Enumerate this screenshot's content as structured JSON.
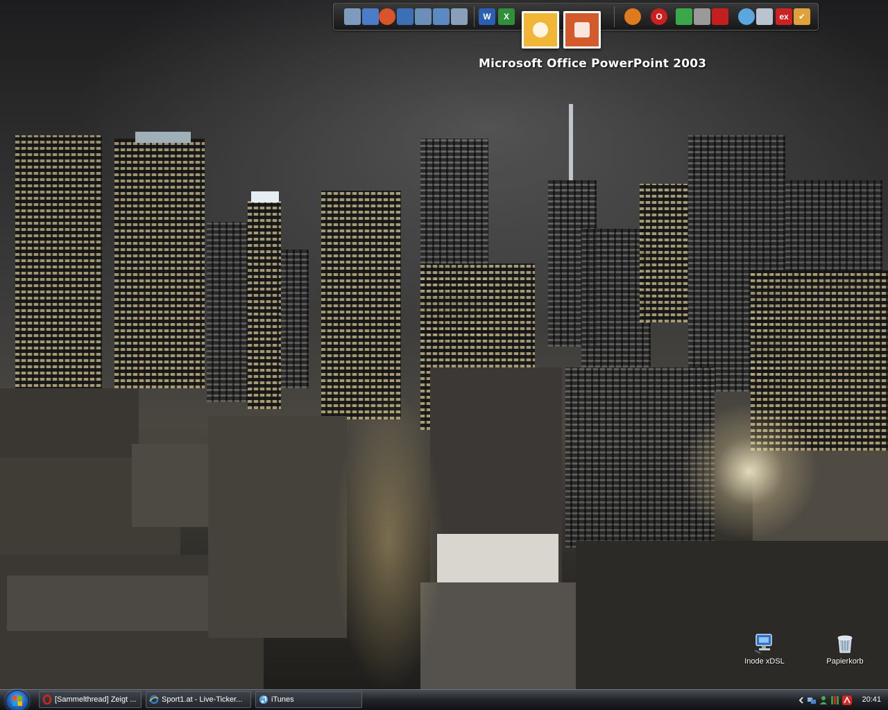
{
  "dock": {
    "tooltip_label": "Microsoft Office PowerPoint 2003",
    "icons": [
      {
        "name": "recycle-bin-icon",
        "color": "#7d9bbd"
      },
      {
        "name": "network-icon",
        "color": "#4b7cc9"
      },
      {
        "name": "firefox-alt-icon",
        "color": "#d9542b"
      },
      {
        "name": "window-icon",
        "color": "#3c6fb5"
      },
      {
        "name": "explorer-icon",
        "color": "#6c8fb8"
      },
      {
        "name": "control-panel-icon",
        "color": "#5b89c2"
      },
      {
        "name": "arrow-icon",
        "color": "#8aa0b8"
      },
      {
        "name": "word-icon",
        "color": "#2b5fb3",
        "glyph": "W"
      },
      {
        "name": "excel-icon",
        "color": "#2f8f3a",
        "glyph": "X"
      },
      {
        "name": "outlook-icon",
        "color": "#f2b637"
      },
      {
        "name": "powerpoint-icon",
        "color": "#d35a2a"
      },
      {
        "name": "firefox-icon",
        "color": "#e07a1f"
      },
      {
        "name": "opera-icon",
        "color": "#cc1f1f",
        "glyph": "O"
      },
      {
        "name": "folder-icon",
        "color": "#3aa84a"
      },
      {
        "name": "printer-icon",
        "color": "#9a9a9a"
      },
      {
        "name": "winamp-icon",
        "color": "#c41f1f"
      },
      {
        "name": "itunes-icon",
        "color": "#5aa7e0"
      },
      {
        "name": "ipod-icon",
        "color": "#b9c4cf"
      },
      {
        "name": "ex-icon",
        "color": "#cc2222",
        "glyph": "ex"
      },
      {
        "name": "checkmark-icon",
        "color": "#e0a13a",
        "glyph": "✔"
      }
    ]
  },
  "desktop": {
    "icons": [
      {
        "label": "Inode xDSL",
        "name": "inode-xdsl-icon"
      },
      {
        "label": "Papierkorb",
        "name": "papierkorb-icon"
      }
    ]
  },
  "taskbar": {
    "buttons": [
      {
        "label": "[Sammelthread] Zeigt ...",
        "name": "opera-icon",
        "icon_color": "#cc1f1f"
      },
      {
        "label": "Sport1.at - Live-Ticker...",
        "name": "ie-icon",
        "icon_color": "#2a7fd4"
      },
      {
        "label": "iTunes",
        "name": "itunes-icon",
        "icon_color": "#5aa7e0"
      }
    ],
    "clock": "20:41",
    "tray_icons": [
      {
        "name": "chevron-left-icon",
        "color": "#dddddd"
      },
      {
        "name": "network-icon",
        "color": "#7fb3e8"
      },
      {
        "name": "user-icon",
        "color": "#4fa84f"
      },
      {
        "name": "volume-meter-icon",
        "color": "#3b9c3b"
      },
      {
        "name": "antivirus-icon",
        "color": "#d62424"
      }
    ]
  }
}
